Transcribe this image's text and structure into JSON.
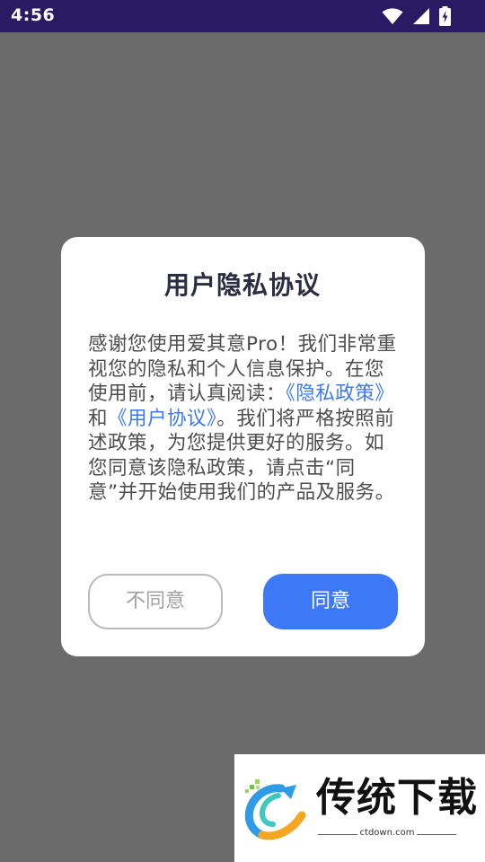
{
  "status_bar": {
    "time": "4:56",
    "icons": [
      "wifi-icon",
      "signal-icon",
      "battery-charging-icon"
    ],
    "background": "#2a1a63"
  },
  "dialog": {
    "title": "用户隐私协议",
    "body": {
      "intro": "感谢您使用爱其意Pro！我们非常重视您的隐私和个人信息保护。在您使用前，请认真阅读：",
      "link_privacy": "《隐私政策》",
      "conjunction": "和",
      "link_agreement": "《用户协议》",
      "outro": "。我们将严格按照前述政策，为您提供更好的服务。如您同意该隐私政策，请点击“同意”并开始使用我们的产品及服务。"
    },
    "decline_label": "不同意",
    "agree_label": "同意"
  },
  "watermark": {
    "name": "传统下载",
    "url": "ctdown.com"
  },
  "colors": {
    "overlay": "#6b6b6b",
    "accent": "#3d78f6",
    "link": "#3b78f6",
    "title": "#2b2d42"
  }
}
